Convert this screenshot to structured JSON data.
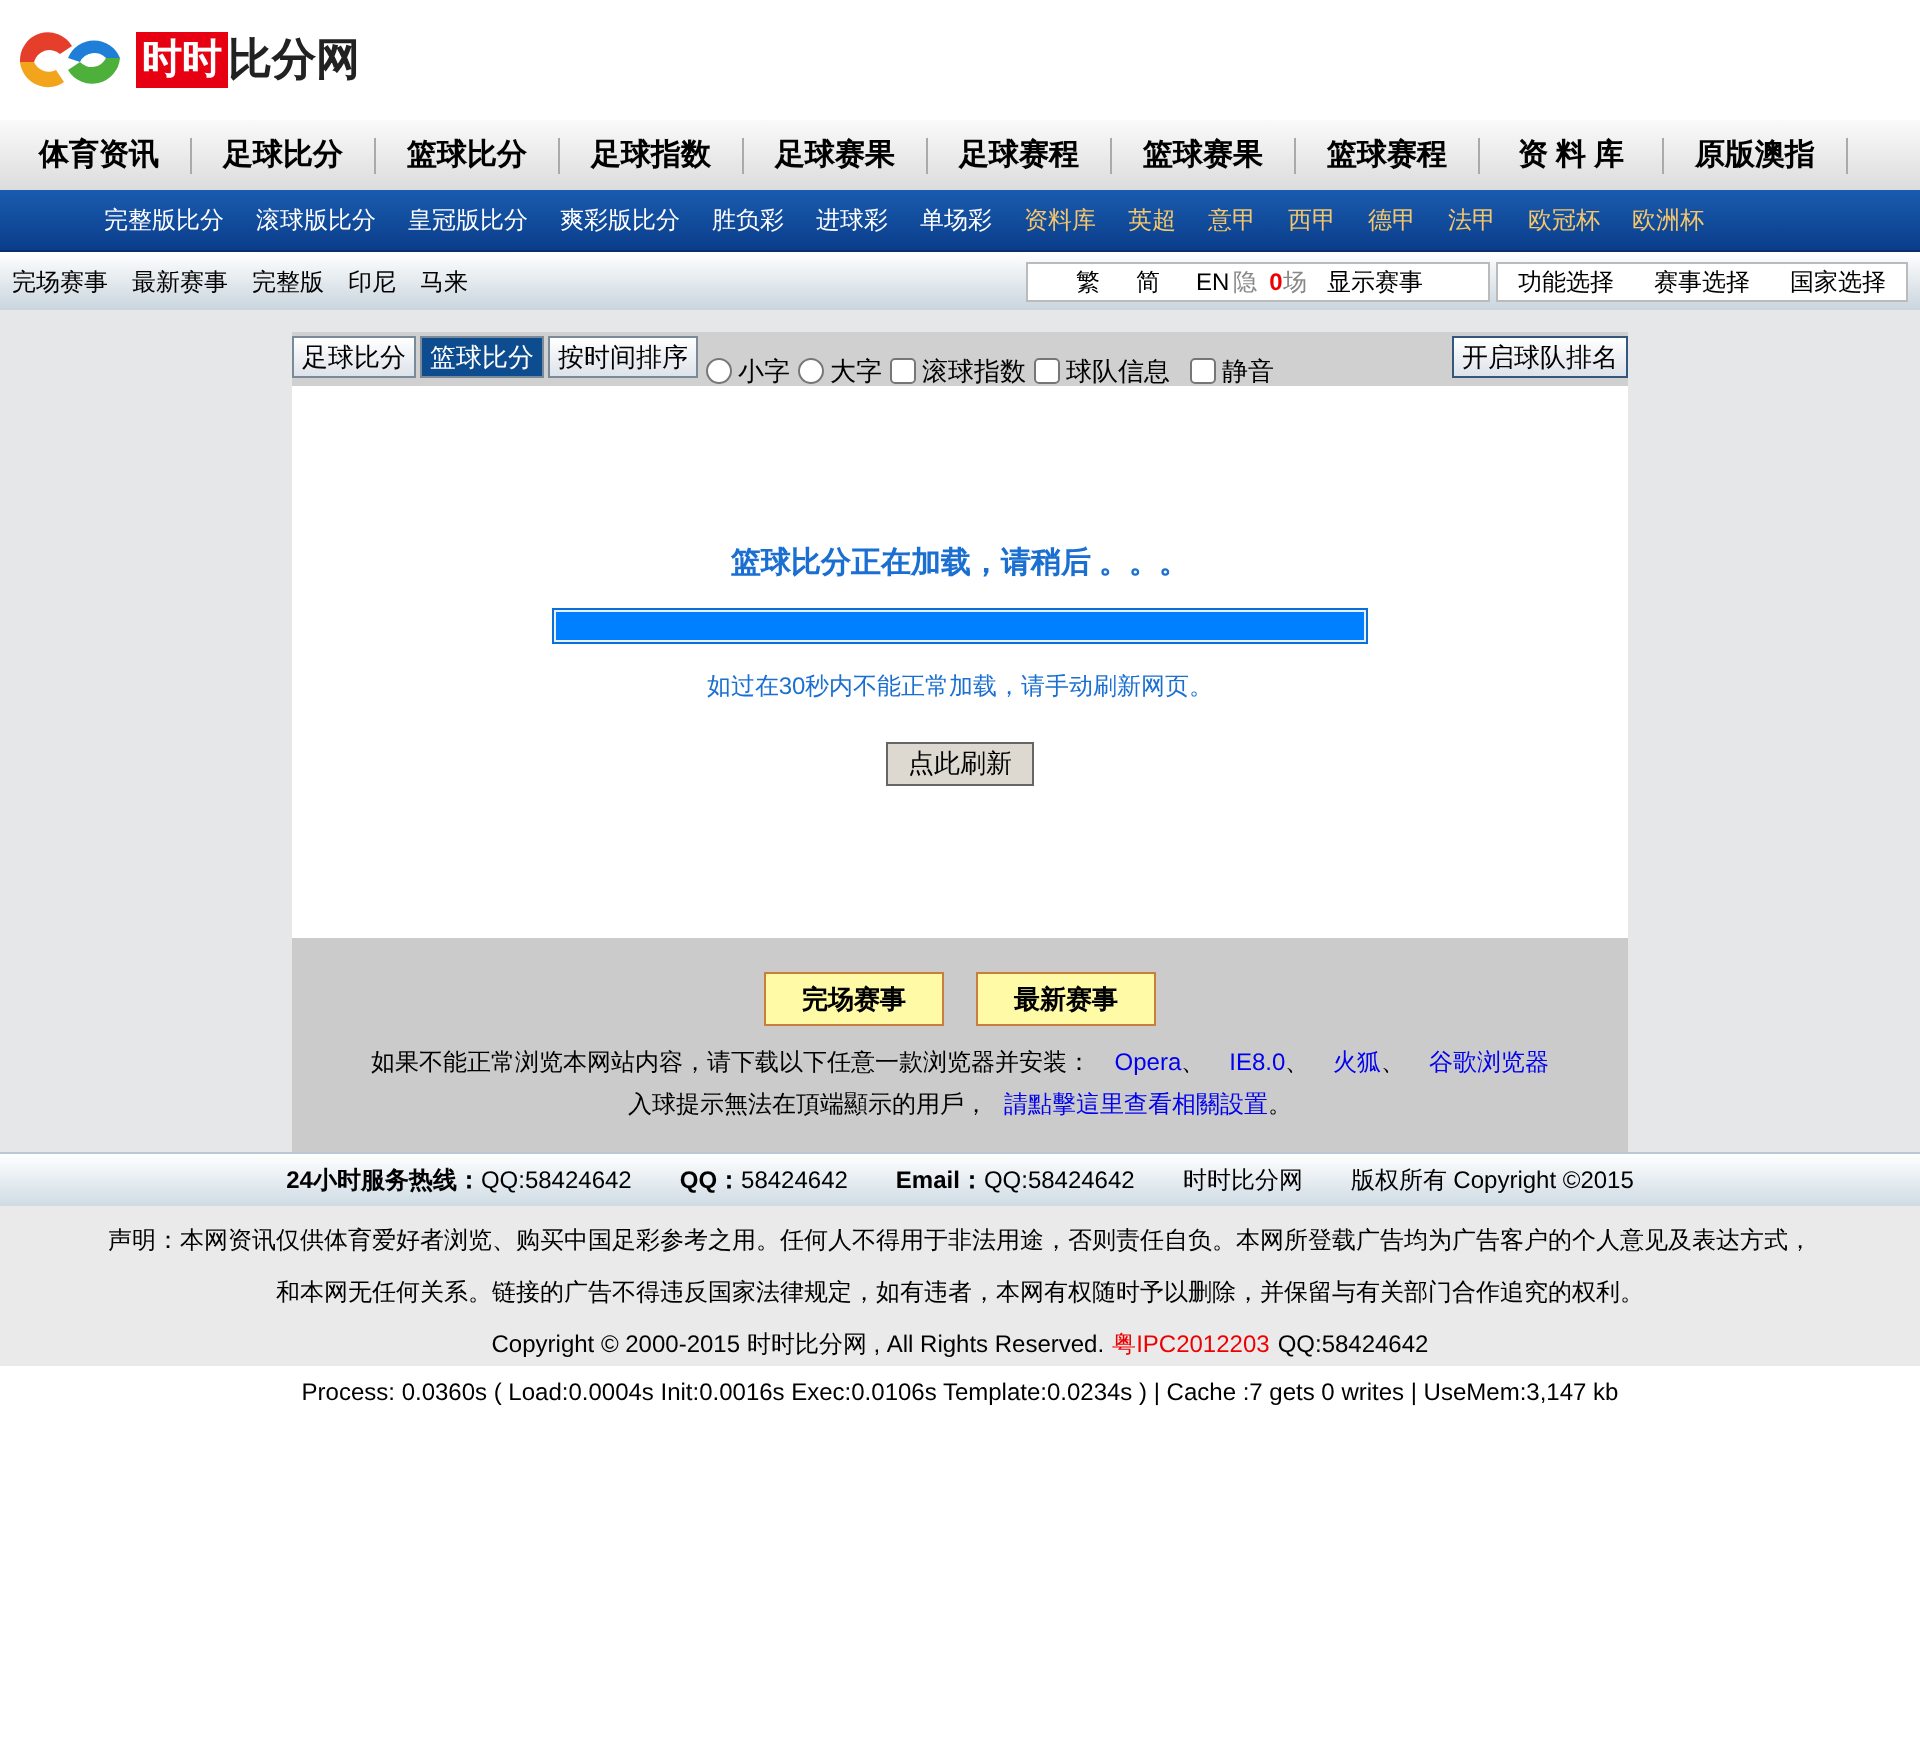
{
  "logo": {
    "badge": "时时",
    "text": "比分网"
  },
  "main_nav": [
    "体育资讯",
    "足球比分",
    "篮球比分",
    "足球指数",
    "足球赛果",
    "足球赛程",
    "篮球赛果",
    "篮球赛程",
    "资 料 库",
    "原版澳指"
  ],
  "sub_nav": [
    {
      "label": "完整版比分",
      "color": "#ffffff"
    },
    {
      "label": "滚球版比分",
      "color": "#ffffff"
    },
    {
      "label": "皇冠版比分",
      "color": "#ffffff"
    },
    {
      "label": "爽彩版比分",
      "color": "#ffffff"
    },
    {
      "label": "胜负彩",
      "color": "#ffffff"
    },
    {
      "label": "进球彩",
      "color": "#ffffff"
    },
    {
      "label": "单场彩",
      "color": "#ffffff"
    },
    {
      "label": "资料库",
      "color": "#f5c76a"
    },
    {
      "label": "英超",
      "color": "#f5c76a"
    },
    {
      "label": "意甲",
      "color": "#f5c76a"
    },
    {
      "label": "西甲",
      "color": "#f5c76a"
    },
    {
      "label": "德甲",
      "color": "#f5c76a"
    },
    {
      "label": "法甲",
      "color": "#f5c76a"
    },
    {
      "label": "欧冠杯",
      "color": "#f5c76a"
    },
    {
      "label": "欧洲杯",
      "color": "#f5c76a"
    }
  ],
  "quick_links": [
    "完场赛事",
    "最新赛事",
    "完整版",
    "印尼",
    "马来"
  ],
  "display_box": {
    "languages": [
      "繁",
      "简",
      "EN"
    ],
    "hidden_label": "隐",
    "hidden_count": "0",
    "hidden_unit": "场",
    "show_matches": "显示赛事"
  },
  "selectors": [
    "功能选择",
    "赛事选择",
    "国家选择"
  ],
  "score_tabs": [
    {
      "label": "足球比分",
      "selected": false
    },
    {
      "label": "篮球比分",
      "selected": true
    },
    {
      "label": "按时间排序",
      "selected": false
    }
  ],
  "options": [
    {
      "kind": "radio",
      "label": "小字",
      "checked": false
    },
    {
      "kind": "radio",
      "label": "大字",
      "checked": false
    },
    {
      "kind": "checkbox",
      "label": "滚球指数",
      "checked": false
    },
    {
      "kind": "checkbox",
      "label": "球队信息",
      "checked": false
    },
    {
      "kind": "checkbox",
      "label": "静音",
      "checked": false
    }
  ],
  "team_rank_button": "开启球队排名",
  "loading": {
    "title": "篮球比分正在加载，请稍后 。。。",
    "level": 1,
    "hint": "如过在30秒内不能正常加载，请手动刷新网页。",
    "refresh_button": "点此刷新"
  },
  "bottom_buttons": [
    "完场赛事",
    "最新赛事"
  ],
  "browser_note": {
    "text": "如果不能正常浏览本网站内容，请下载以下任意一款浏览器并安装：",
    "links": [
      "Opera",
      "IE8.0",
      "火狐",
      "谷歌浏览器"
    ],
    "separator": "、"
  },
  "alert_note": {
    "text": "入球提示無法在頂端顯示的用戶，",
    "link": "請點擊這里查看相關設置",
    "end": "。"
  },
  "contact_bar": [
    {
      "label": "24小时服务热线：",
      "value": "QQ:58424642"
    },
    {
      "label": "QQ：",
      "value": "58424642"
    },
    {
      "label": "Email：",
      "value": "QQ:58424642"
    },
    {
      "value": "时时比分网"
    },
    {
      "value": "版权所有  Copyright ©2015"
    }
  ],
  "disclaimer": [
    "声明：本网资讯仅供体育爱好者浏览、购买中国足彩参考之用。任何人不得用于非法用途，否则责任自负。本网所登载广告均为广告客户的个人意见及表达方式，",
    "和本网无任何关系。链接的广告不得违反国家法律规定，如有违者，本网有权随时予以删除，并保留与有关部门合作追究的权利。"
  ],
  "copyright": {
    "text": "Copyright © 2000-2015 时时比分网 , All Rights Reserved.",
    "icp": "粤IPC2012203",
    "qq": "QQ:58424642"
  },
  "process_info": "Process: 0.0360s ( Load:0.0004s Init:0.0016s Exec:0.0106s Template:0.0234s ) | Cache :7 gets 0 writes | UseMem:3,147 kb"
}
